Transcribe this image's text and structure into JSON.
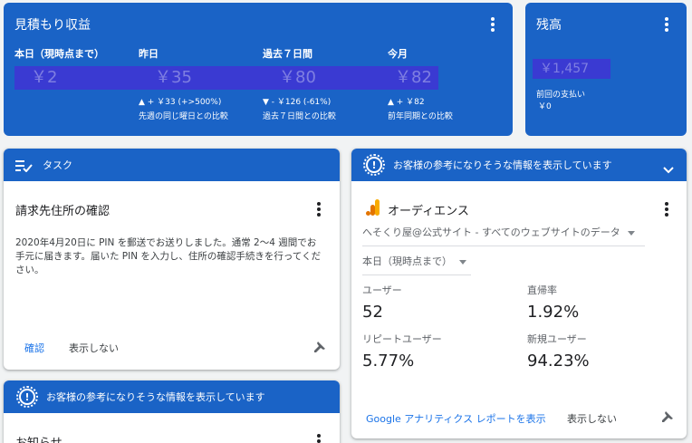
{
  "revenue": {
    "title": "見積もり収益",
    "metrics": [
      {
        "label": "本日（現時点まで）",
        "value": "￥2",
        "delta": "",
        "compare": ""
      },
      {
        "label": "昨日",
        "value": "￥35",
        "delta": "▲ + ￥33 (+>500%)",
        "compare": "先週の同じ曜日との比較"
      },
      {
        "label": "過去７日間",
        "value": "￥80",
        "delta": "▼ - ￥126 (-61%)",
        "compare": "過去７日間との比較"
      },
      {
        "label": "今月",
        "value": "￥82",
        "delta": "▲ + ￥82",
        "compare": "前年同期との比較"
      }
    ]
  },
  "balance": {
    "title": "残高",
    "value": "￥1,457",
    "last_payment_label": "前回の支払い",
    "last_payment_value": "￥0"
  },
  "tasks": {
    "header": "タスク",
    "title": "請求先住所の確認",
    "body": "2020年4月20日に PIN を郵送でお送りしました。通常 2～4 週間でお手元に届きます。届いた PIN を入力し、住所の確認手続きを行ってください。",
    "confirm": "確認",
    "hide": "表示しない"
  },
  "insights_bottom": {
    "header": "お客様の参考になりそうな情報を表示しています",
    "title": "お知らせ"
  },
  "insights_right": {
    "header": "お客様の参考になりそうな情報を表示しています",
    "title": "オーディエンス",
    "property": "へそくり屋@公式サイト - すべてのウェブサイトのデータ",
    "range": "本日（現時点まで）",
    "stats": [
      {
        "label": "ユーザー",
        "value": "52"
      },
      {
        "label": "直帰率",
        "value": "1.92%"
      },
      {
        "label": "リピートユーザー",
        "value": "5.77%"
      },
      {
        "label": "新規ユーザー",
        "value": "94.23%"
      }
    ],
    "report_link": "Google アナリティクス レポートを表示",
    "hide": "表示しない"
  },
  "colors": {
    "brand_blue": "#1a63c6",
    "link": "#1a73e8",
    "analytics_orange": "#f9ab00",
    "analytics_dark": "#e37400"
  },
  "icons": [
    "more-vert-icon",
    "task-list-icon",
    "alert-icon",
    "chevron-down-icon",
    "pin-icon",
    "analytics-icon"
  ]
}
